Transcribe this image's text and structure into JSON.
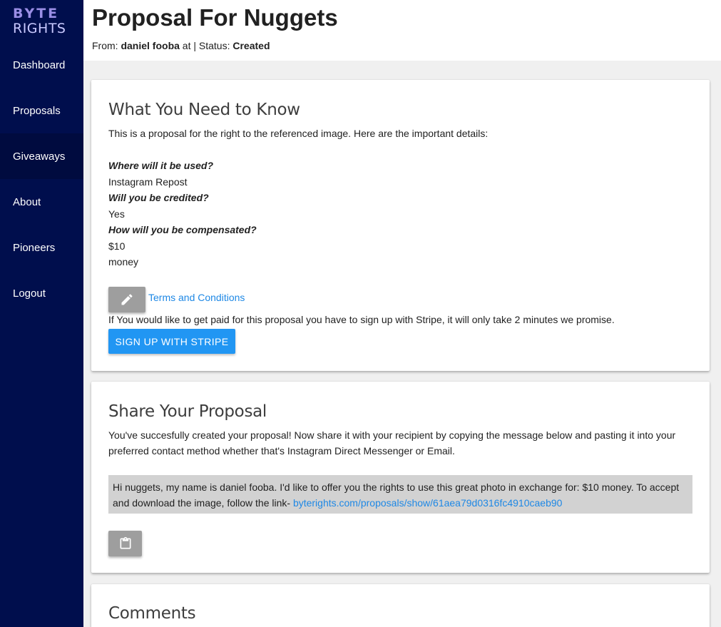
{
  "sidebar": {
    "logo_line1": "BYTE",
    "logo_line2": "RIGHTS",
    "items": [
      {
        "label": "Dashboard"
      },
      {
        "label": "Proposals"
      },
      {
        "label": "Giveaways"
      },
      {
        "label": "About"
      },
      {
        "label": "Pioneers"
      },
      {
        "label": "Logout"
      }
    ]
  },
  "header": {
    "title": "Proposal For Nuggets",
    "from_prefix": "From:",
    "from_name": "daniel fooba",
    "at_text": "at | Status:",
    "status": "Created"
  },
  "know_card": {
    "title": "What You Need to Know",
    "intro": "This is a proposal for the right to the referenced image. Here are the important details:",
    "q1": "Where will it be used?",
    "a1": "Instagram Repost",
    "q2": "Will you be credited?",
    "a2": "Yes",
    "q3": "How will you be compensated?",
    "a3_amount": "$10",
    "a3_type": "money",
    "terms_link": "Terms and Conditions",
    "stripe_note": "If You would like to get paid for this proposal you have to sign up with Stripe, it will only take 2 minutes we promise.",
    "stripe_button": "SIGN UP WITH STRIPE"
  },
  "share_card": {
    "title": "Share Your Proposal",
    "description": "You've succesfully created your proposal! Now share it with your recipient by copying the message below and pasting it into your preferred contact method whether that's Instagram Direct Messenger or Email.",
    "message": "Hi nuggets, my name is daniel fooba. I'd like to offer you the rights to use this great photo in exchange for: $10 money. To accept and download the image, follow the link- ",
    "link": "byterights.com/proposals/show/61aea79d0316fc4910caeb90"
  },
  "comments_card": {
    "title": "Comments"
  },
  "icons": {
    "edit": "pencil-icon",
    "copy": "clipboard-icon"
  },
  "colors": {
    "sidebar_bg": "#000e4d",
    "primary_button": "#2196f3",
    "link": "#1e88e5",
    "grey_button": "#9e9e9e",
    "message_bg": "#d2d2d2"
  }
}
